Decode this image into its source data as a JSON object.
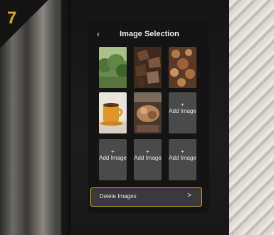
{
  "step": {
    "number": "7",
    "color": "#e3a623"
  },
  "screen": {
    "title": "Image Selection",
    "back_icon": "chevron-left-icon"
  },
  "tiles": [
    {
      "type": "image",
      "subject": "forest trees"
    },
    {
      "type": "image",
      "subject": "chocolate pieces"
    },
    {
      "type": "image",
      "subject": "cookies and nuts"
    },
    {
      "type": "image",
      "subject": "coffee mug"
    },
    {
      "type": "image",
      "subject": "food dish"
    },
    {
      "type": "add",
      "plus": "+",
      "label": "Add Image"
    },
    {
      "type": "add",
      "plus": "+",
      "label": "Add Image"
    },
    {
      "type": "add",
      "plus": "+",
      "label": "Add Image"
    },
    {
      "type": "add",
      "plus": "+",
      "label": "Add Image"
    }
  ],
  "delete": {
    "label": "Delete Images",
    "chevron": ">",
    "border_color": "#e3a623"
  }
}
